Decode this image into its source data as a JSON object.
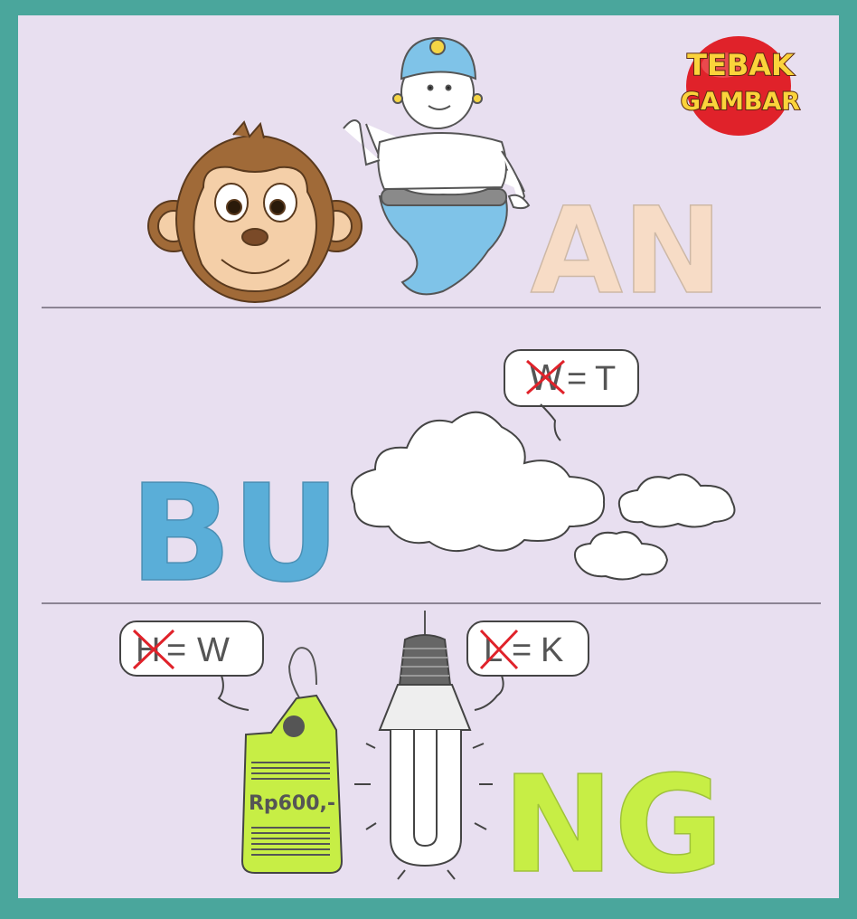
{
  "logo": {
    "line1": "TEBAK",
    "line2": "GAMBAR"
  },
  "colors": {
    "frame": "#4aa69c",
    "board": "#e8dff0",
    "divider": "#8c8494",
    "peach": "#f7dcc6",
    "blue": "#5aaed8",
    "lime": "#c7ee45",
    "red": "#e0222a"
  },
  "row1": {
    "pictures": [
      "monkey-face",
      "genie"
    ],
    "suffix": "AN"
  },
  "row2": {
    "prefix": "BU",
    "pictures": [
      "cloud"
    ],
    "bubble": {
      "old": "W",
      "equals": "=",
      "new": "T"
    }
  },
  "row3": {
    "pictures": [
      "price-tag",
      "light-bulb"
    ],
    "tag_price": "Rp600,-",
    "suffix": "NG",
    "bubble_left": {
      "old": "H",
      "equals": "=",
      "new": "W"
    },
    "bubble_right": {
      "old": "L",
      "equals": "=",
      "new": "K"
    }
  }
}
